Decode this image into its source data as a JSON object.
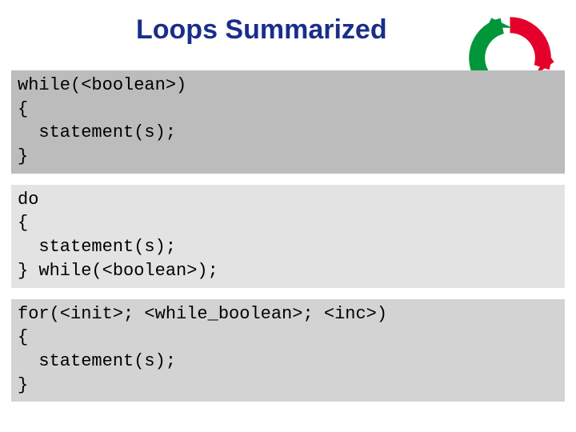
{
  "title": "Loops Summarized",
  "blocks": {
    "while_loop": "while(<boolean>)\n{\n  statement(s);\n}",
    "do_while_loop": "do\n{\n  statement(s);\n} while(<boolean>);",
    "for_loop": "for(<init>; <while_boolean>; <inc>)\n{\n  statement(s);\n}"
  },
  "icon": {
    "name": "cycle-arrows",
    "colors": {
      "top": "#e4002b",
      "left": "#009639",
      "right": "#0033a0"
    }
  }
}
